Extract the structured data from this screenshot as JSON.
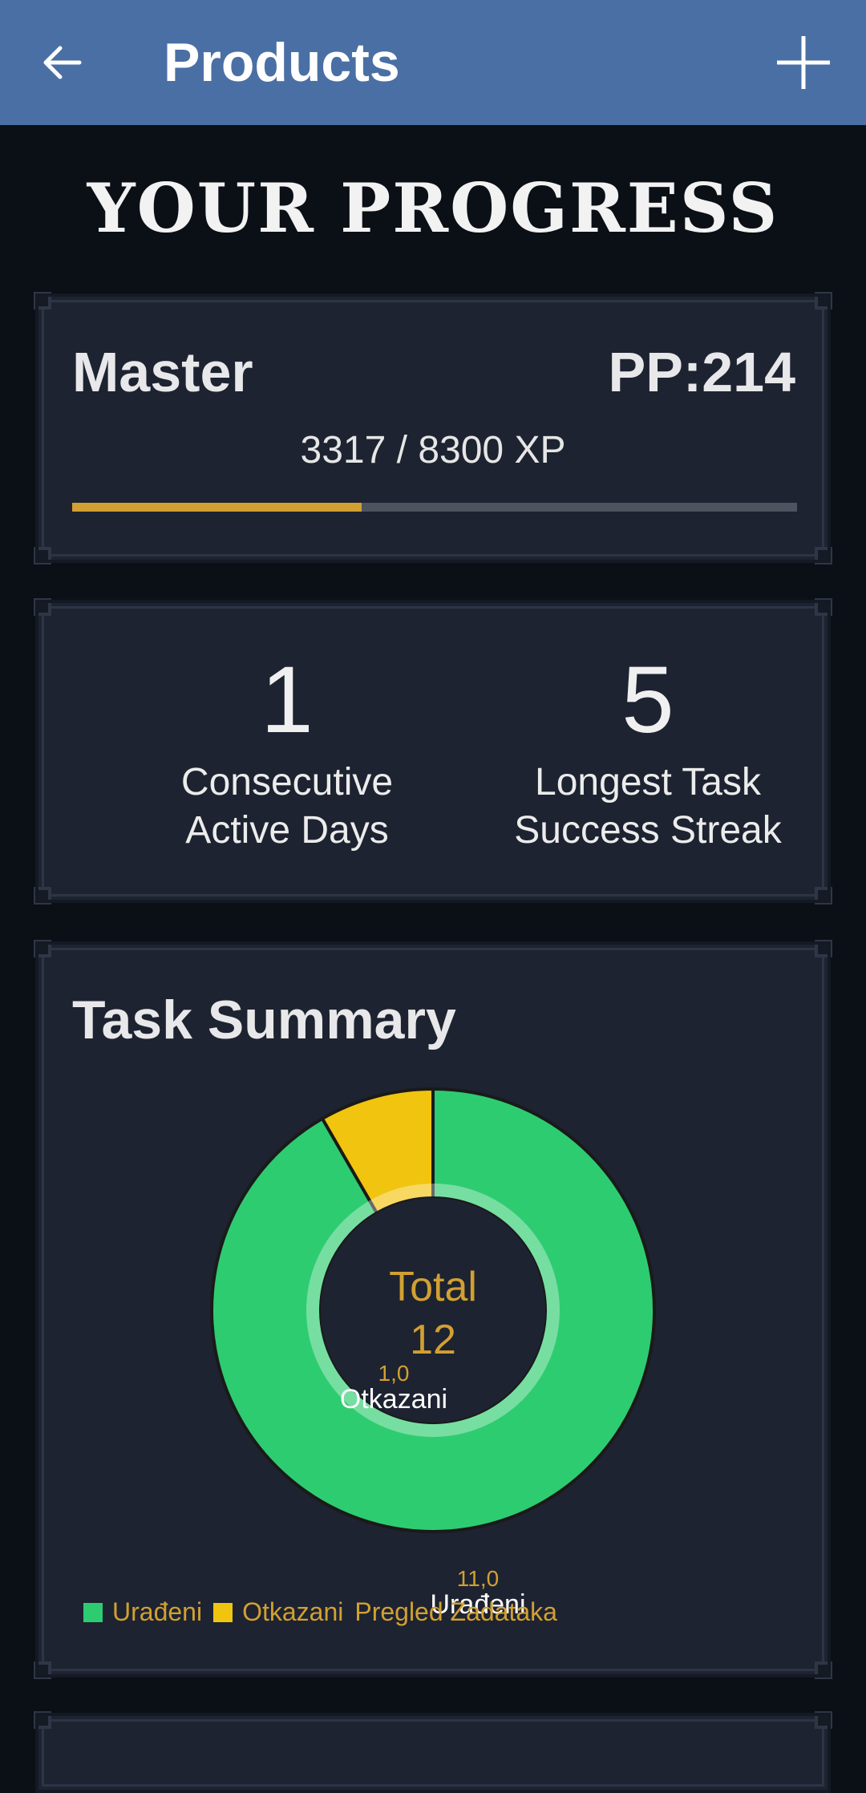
{
  "appbar": {
    "title": "Products",
    "back_icon": "arrow-left-icon",
    "add_icon": "plus-icon",
    "background": "#4a6fa5"
  },
  "heading": "YOUR PROGRESS",
  "rank": {
    "name": "Master",
    "pp": "PP:214",
    "xp_text": "3317 / 8300 XP",
    "xp_current": 3317,
    "xp_max": 8300,
    "bar_color": "#d2a032"
  },
  "stats": [
    {
      "value": "1",
      "label_line1": "Consecutive",
      "label_line2": "Active Days"
    },
    {
      "value": "5",
      "label_line1": "Longest Task",
      "label_line2": "Success Streak"
    }
  ],
  "summary": {
    "title": "Task Summary",
    "center_line1": "Total",
    "center_line2": "12",
    "legend_title": "Pregled Zadataka"
  },
  "chart_data": {
    "type": "pie",
    "title": "",
    "legend_placement": "bottom-left",
    "slices": [
      {
        "label": "Urađeni",
        "value": 11,
        "value_label": "11,0",
        "color": "#2ecc71"
      },
      {
        "label": "Otkazani",
        "value": 1,
        "value_label": "1,0",
        "color": "#f1c40f"
      }
    ],
    "total": 12
  },
  "colors": {
    "background": "#0b0f16",
    "card": "#1d2330",
    "accent": "#d2a032"
  }
}
